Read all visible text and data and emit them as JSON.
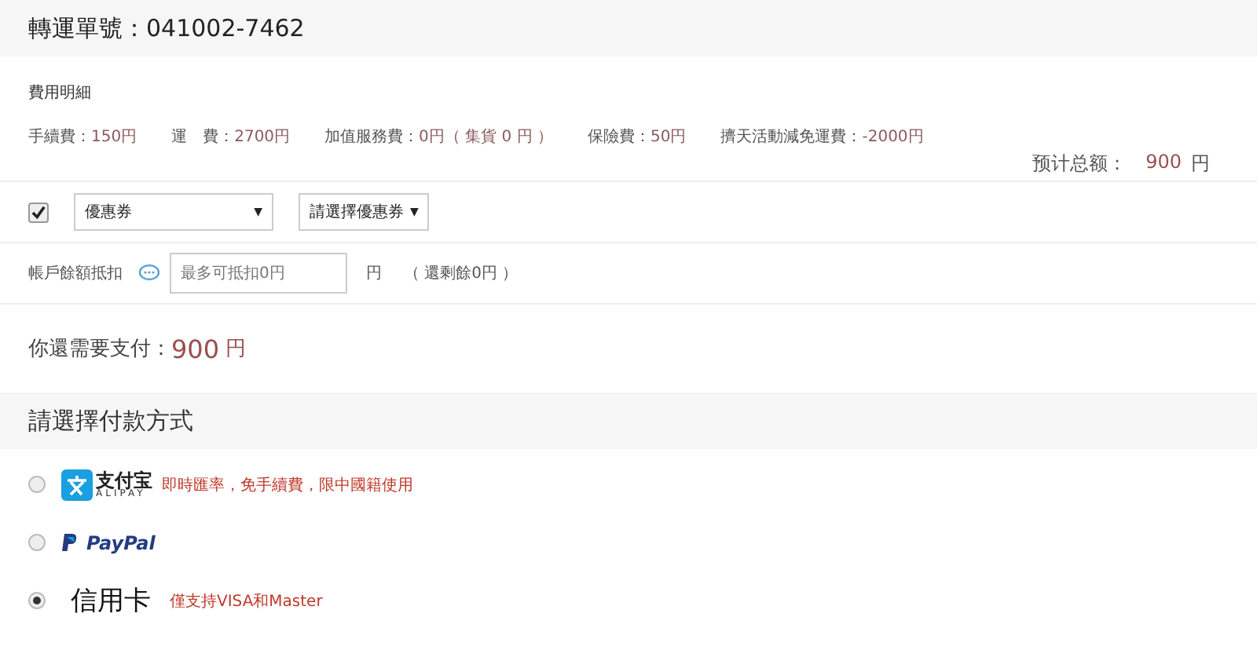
{
  "header": {
    "title": "轉運單號：041002-7462"
  },
  "fees": {
    "title": "費用明細",
    "items": [
      {
        "label": "手續費：",
        "value": "150円"
      },
      {
        "label": "運　費：",
        "value": "2700円"
      },
      {
        "label": "加值服務費：",
        "value": "0円（ 集貨 0 円 ）"
      },
      {
        "label": "保險費：",
        "value": "50円"
      },
      {
        "label": "擠天活動減免運費：",
        "value": "-2000円"
      }
    ],
    "total_label": "预计总额：",
    "total_value": "900",
    "total_unit": "円"
  },
  "coupon": {
    "checked": true,
    "select": "優惠券",
    "select2": "請選擇優惠券",
    "caret": "▼"
  },
  "balance": {
    "label": "帳戶餘額抵扣",
    "placeholder": "最多可抵扣0円",
    "unit": "円",
    "note": "（ 還剩餘0円 ）"
  },
  "due": {
    "label": "你還需要支付：",
    "value": "900",
    "unit": "円"
  },
  "payment": {
    "title": "請選擇付款方式",
    "methods": [
      {
        "kind": "alipay",
        "selected": false,
        "logo_cn": "支付宝",
        "logo_en": "ALIPAY",
        "note": "即時匯率，免手續費，限中國籍使用"
      },
      {
        "kind": "paypal",
        "selected": false,
        "logo": "PayPal"
      },
      {
        "kind": "card",
        "selected": true,
        "name": "信用卡",
        "note": "僅支持VISA和Master"
      }
    ]
  }
}
